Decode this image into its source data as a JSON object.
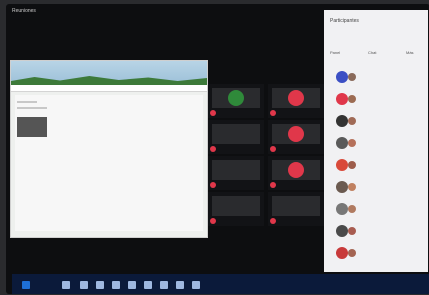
{
  "window": {
    "title": "Reuniones"
  },
  "panel": {
    "title": "Participantes",
    "tabs": [
      "Panel",
      "Chat",
      "Más"
    ]
  },
  "participants": [
    {
      "name": "",
      "color": "#3b4fc4",
      "color2": "#8a6a5a"
    },
    {
      "name": "",
      "color": "#e0374a",
      "color2": "#9c6b52"
    },
    {
      "name": "",
      "color": "#333333",
      "color2": "#a06a56"
    },
    {
      "name": "",
      "color": "#5a5a5a",
      "color2": "#b5705a"
    },
    {
      "name": "",
      "color": "#d94a3a",
      "color2": "#9d5c4a"
    },
    {
      "name": "",
      "color": "#6b5a50",
      "color2": "#c08060"
    },
    {
      "name": "",
      "color": "#777777",
      "color2": "#b07a60"
    },
    {
      "name": "",
      "color": "#4a4a4a",
      "color2": "#a85c50"
    },
    {
      "name": "",
      "color": "#c83a3a",
      "color2": "#a46452"
    }
  ],
  "tiles": [
    {
      "name": "",
      "avatar": "#2f8a3a"
    },
    {
      "name": "",
      "avatar": "#e0374a"
    },
    {
      "name": "",
      "avatar": ""
    },
    {
      "name": "",
      "avatar": "#e0374a"
    },
    {
      "name": "",
      "avatar": ""
    },
    {
      "name": "",
      "avatar": "#e0374a"
    },
    {
      "name": "",
      "avatar": ""
    },
    {
      "name": "",
      "avatar": ""
    }
  ],
  "taskbar": {
    "clock": ""
  }
}
